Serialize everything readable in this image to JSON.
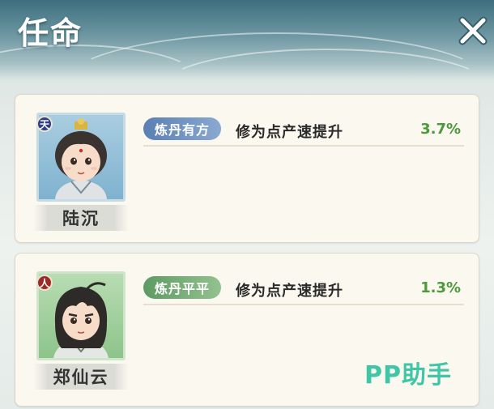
{
  "header": {
    "title": "任命"
  },
  "officials": [
    {
      "name": "陆沉",
      "grade": "天",
      "skill_name": "炼丹有方",
      "skill_desc": "修为点产速提升",
      "skill_value": "3.7%"
    },
    {
      "name": "郑仙云",
      "grade": "人",
      "skill_name": "炼丹平平",
      "skill_desc": "修为点产速提升",
      "skill_value": "1.3%"
    }
  ],
  "watermark": "PP助手",
  "colors": {
    "bonus_value": "#4c9a3c",
    "tag_blue": "#5a7fb3",
    "tag_green": "#5e9a63",
    "watermark": "#3fc6a6"
  }
}
